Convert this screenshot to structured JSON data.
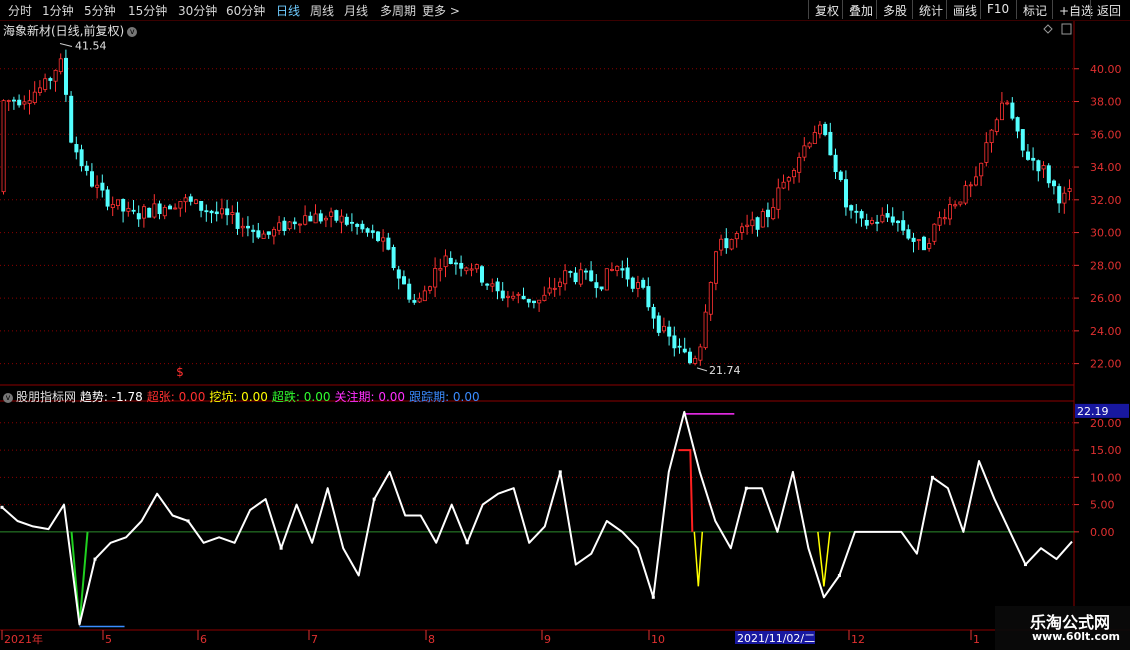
{
  "toolbar": {
    "periods": [
      "分时",
      "1分钟",
      "5分钟",
      "15分钟",
      "30分钟",
      "60分钟",
      "日线",
      "周线",
      "月线",
      "多周期",
      "更多"
    ],
    "active_period": "日线",
    "tools": [
      "复权",
      "叠加",
      "多股",
      "统计",
      "画线",
      "F10",
      "标记",
      "+自选",
      "返回"
    ]
  },
  "stock": {
    "title": "海象新材(日线,前复权)",
    "high_label": "41.54",
    "low_label": "21.74"
  },
  "indicator": {
    "name": "股朋指标网",
    "items": [
      {
        "label": "趋势:",
        "value": "-1.78",
        "color": "#ffffff"
      },
      {
        "label": "超张:",
        "value": "0.00",
        "color": "#ff3030"
      },
      {
        "label": "挖坑:",
        "value": "0.00",
        "color": "#ffff00"
      },
      {
        "label": "超跌:",
        "value": "0.00",
        "color": "#30ff30"
      },
      {
        "label": "关注期:",
        "value": "0.00",
        "color": "#ff30ff"
      },
      {
        "label": "跟踪期:",
        "value": "0.00",
        "color": "#3a8cff"
      }
    ],
    "current_value_box": "22.19"
  },
  "date_axis": {
    "cursor_label": "2021/11/02/二",
    "labels": [
      "2021年",
      "5",
      "6",
      "7",
      "8",
      "9",
      "10",
      "12",
      "1"
    ]
  },
  "watermark": {
    "line1": "乐淘公式网",
    "line2": "www.60lt.com"
  },
  "colors": {
    "up": "#ff3232",
    "down": "#54ffff",
    "grid": "#8b0000",
    "axis_label": "#e03030",
    "trend_line": "#ffffff",
    "zero_line": "#2d8c2d",
    "surge": "#ff2020",
    "dip": "#ffff00",
    "oversold": "#20d020",
    "watch": "#ff30ff",
    "track": "#3a8cff"
  },
  "chart_data": [
    {
      "type": "candlestick",
      "title": "海象新材(日线,前复权)",
      "ylim": [
        21,
        42
      ],
      "y_ticks": [
        22.0,
        24.0,
        26.0,
        28.0,
        30.0,
        32.0,
        34.0,
        36.0,
        38.0,
        40.0
      ],
      "x_labels": [
        "2021年",
        "5",
        "6",
        "7",
        "8",
        "9",
        "10",
        "12",
        "1"
      ],
      "annotations": [
        {
          "text": "41.54",
          "value": 41.54
        },
        {
          "text": "21.74",
          "value": 21.74
        }
      ],
      "close_by_month": {
        "Apr_start": 38.0,
        "Apr_peak": 41.54,
        "May": 32.0,
        "Jun": 31.0,
        "Jul": 31.0,
        "Aug": 27.5,
        "Sep": 26.5,
        "Oct_low": 21.74,
        "Nov": 30.0,
        "Dec": 34.0,
        "Jan": 37.5
      }
    },
    {
      "type": "line",
      "title": "股朋指标网",
      "ylim": [
        -18,
        24
      ],
      "y_ticks": [
        0.0,
        5.0,
        10.0,
        15.0,
        20.0
      ],
      "series": [
        {
          "name": "趋势",
          "values": [
            4.5,
            2,
            1,
            0.5,
            5,
            -17,
            -5,
            -2,
            -1,
            2,
            7,
            3,
            2,
            -2,
            -1,
            -2,
            4,
            6,
            -3,
            5,
            -2,
            8,
            -3,
            -8,
            6,
            11,
            3,
            3,
            -2,
            5,
            -2,
            5,
            7,
            8,
            -2,
            1,
            11,
            -6,
            -4,
            2,
            0,
            -3,
            -12,
            11,
            22,
            11,
            2,
            -3,
            8,
            8,
            0,
            11,
            -3,
            -12,
            -8,
            0,
            0,
            0,
            0,
            -4,
            10,
            8,
            0,
            13,
            6,
            0,
            -6,
            -3,
            -5,
            -1.78
          ]
        }
      ]
    }
  ]
}
